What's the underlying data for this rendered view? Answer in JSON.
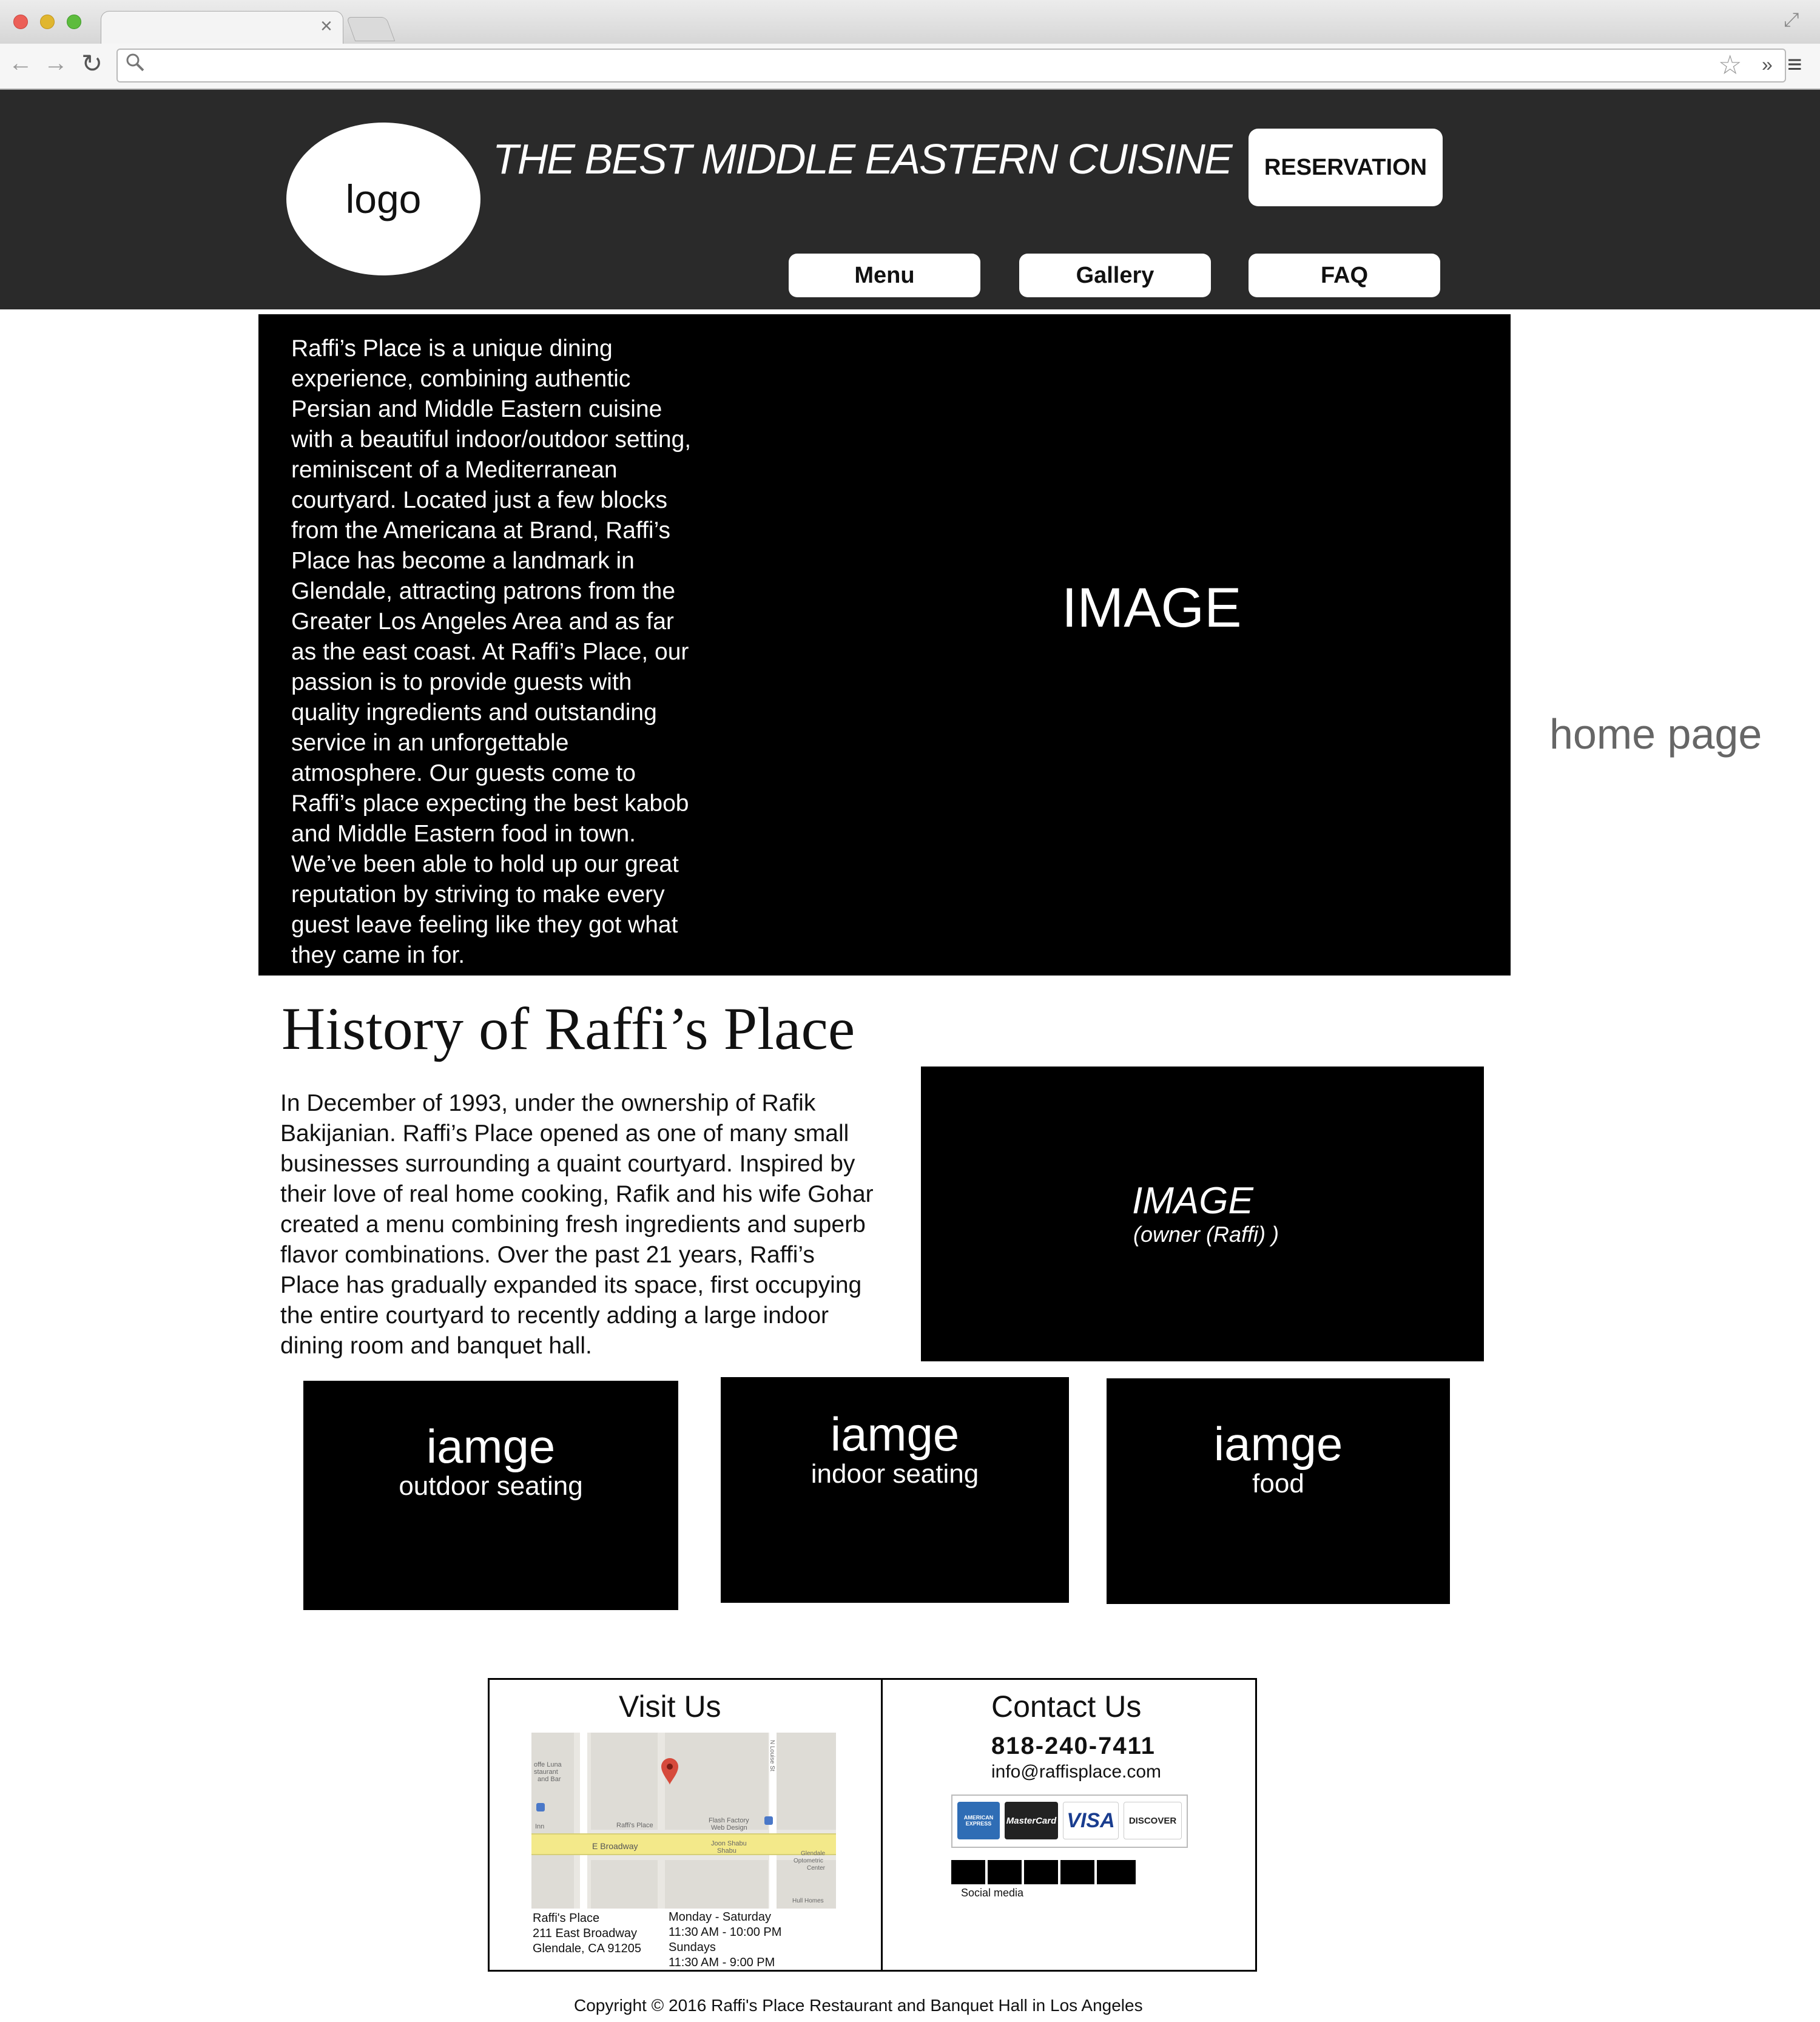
{
  "browser": {
    "tab_close_glyph": "×",
    "url": "",
    "traffic_lights": [
      "#ec5f57",
      "#e0b62f",
      "#5dbc3d"
    ]
  },
  "header": {
    "logo": "logo",
    "tagline": "THE BEST MIDDLE EASTERN CUISINE",
    "reservation": "RESERVATION",
    "nav": [
      "Menu",
      "Gallery",
      "FAQ"
    ]
  },
  "hero": {
    "text": "Raffi’s Place is a unique dining experience, combining authentic Persian and Middle Eastern cuisine with a beautiful indoor/outdoor setting, reminiscent of a Mediterranean courtyard. Located just a few blocks from the Americana at Brand, Raffi’s Place has become a landmark in Glendale, attracting patrons from the Greater Los Angeles Area and as far as the east coast. At Raffi’s Place, our passion is to provide guests with quality ingredients and outstanding service in an unforgettable atmosphere. Our guests come to Raffi’s place expecting the best kabob and Middle Eastern food in town. We’ve been able to hold up our great reputation by striving to make every guest leave feeling like they got what they came in for.",
    "image_label": "IMAGE"
  },
  "page_label": "home page",
  "history": {
    "title": "History of Raffi’s Place",
    "text": "In December of 1993, under the ownership of Rafik Bakijanian. Raffi’s Place opened as one of many small businesses surrounding a quaint courtyard. Inspired by their love of real home cooking, Rafik and his wife Gohar created a menu combining fresh ingredients and superb flavor combinations. Over the past 21 years, Raffi’s Place has gradually expanded its space, first occupying the entire courtyard to recently adding a large indoor dining room and banquet hall.",
    "owner_image": "IMAGE",
    "owner_caption": "(owner (Raffi) )"
  },
  "gallery": [
    {
      "title": "iamge",
      "subtitle": "outdoor seating"
    },
    {
      "title": "iamge",
      "subtitle": "indoor seating"
    },
    {
      "title": "iamge",
      "subtitle": "food"
    }
  ],
  "footer": {
    "visit_title": "Visit Us",
    "map_labels": [
      "offe Luna",
      "staurant",
      "and Bar",
      "E Broadway",
      "Raffi's Place",
      "Flash Factory",
      "Web Design",
      "Joon Shabu",
      "Shabu",
      "Glendale",
      "Optometric",
      "Center",
      "Hull Homes",
      "N Louise St",
      "Inn"
    ],
    "address": [
      "Raffi's Place",
      "211 East Broadway",
      "Glendale, CA 91205"
    ],
    "hours": [
      "Monday - Saturday",
      "11:30 AM - 10:00 PM",
      "Sundays",
      "11:30 AM - 9:00 PM"
    ],
    "contact_title": "Contact Us",
    "phone": "818-240-7411",
    "email": "info@raffisplace.com",
    "cards": [
      "AMERICAN EXPRESS",
      "MasterCard",
      "VISA",
      "DISCOVER"
    ],
    "social_label": "Social media",
    "copyright": "Copyright © 2016 Raffi's Place Restaurant and Banquet Hall in Los Angeles"
  }
}
